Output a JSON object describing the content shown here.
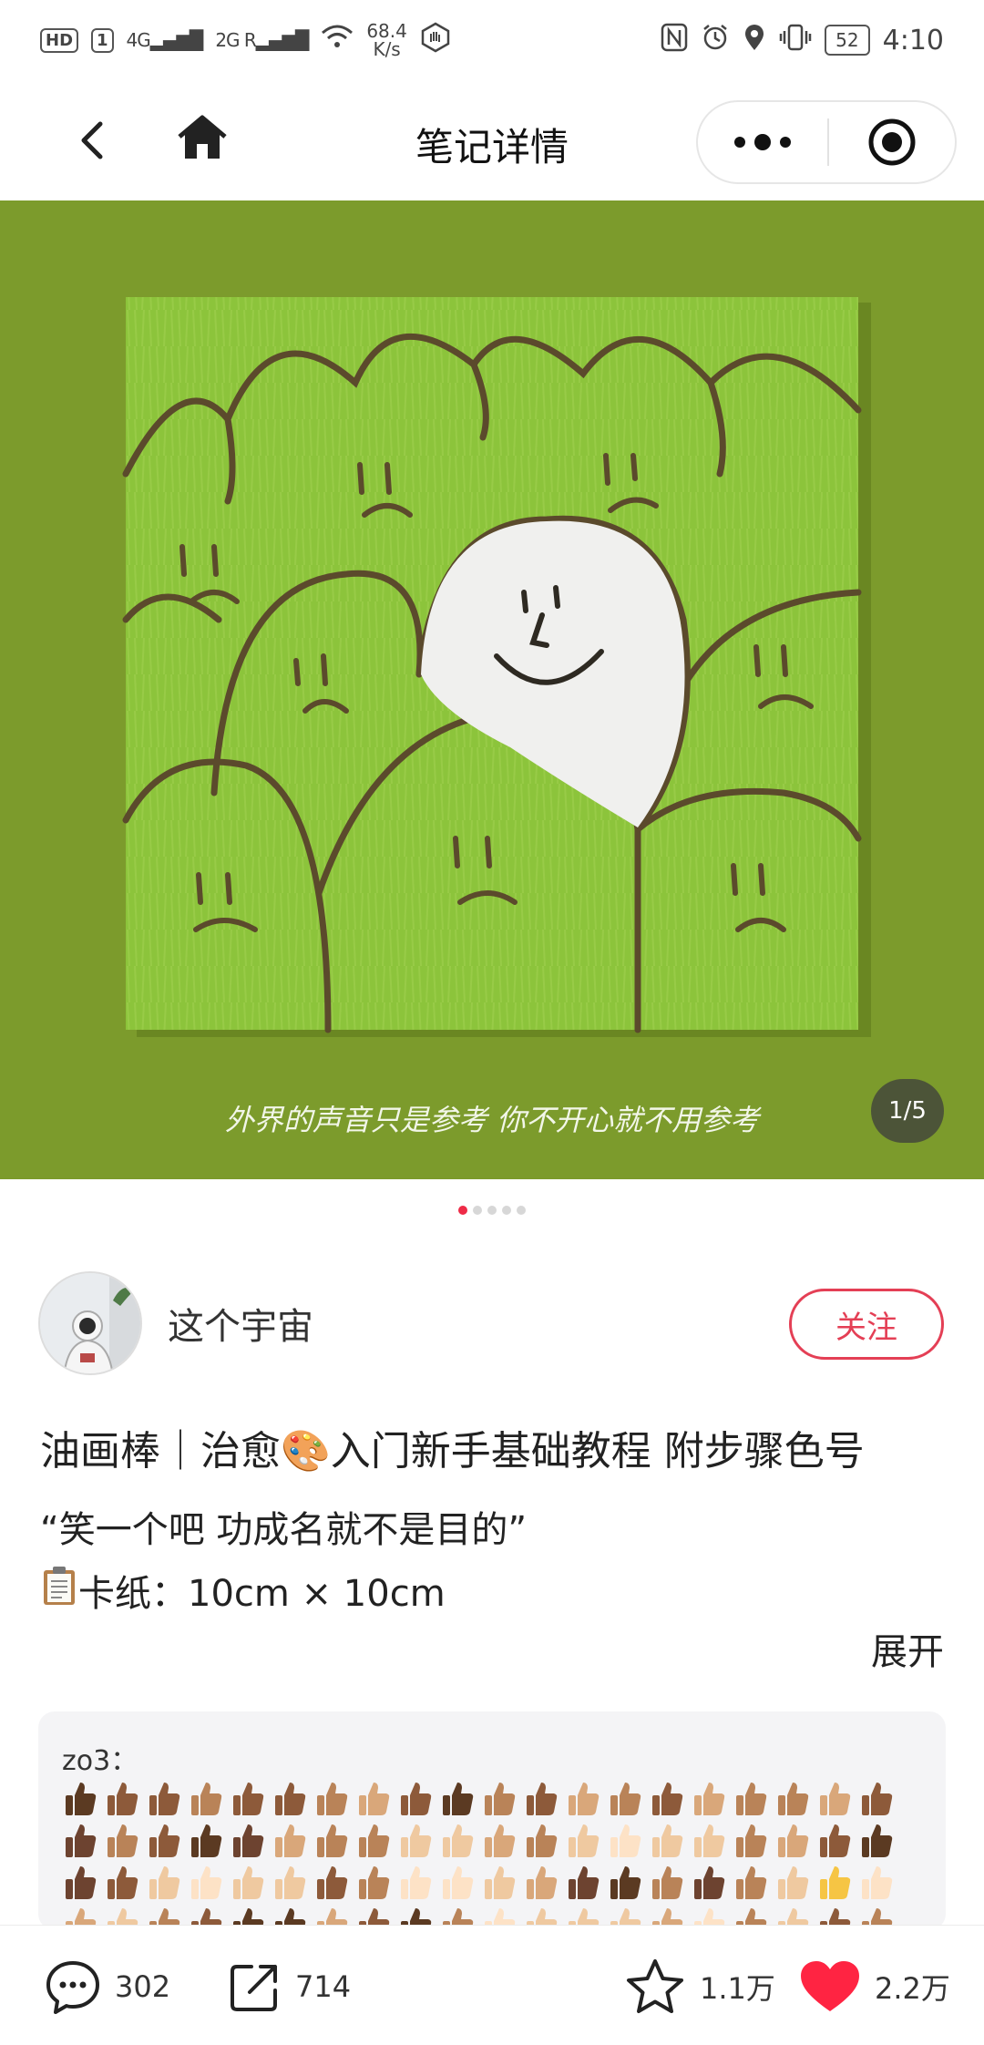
{
  "status_bar": {
    "left_icons": [
      "hd-icon",
      "sim-icon",
      "signal-4g-icon",
      "signal-2g-icon",
      "wifi-icon",
      "hand-icon"
    ],
    "hd_label": "HD",
    "sim_label": "1",
    "net1": "4G",
    "net2": "2G R",
    "speed_value": "68.4",
    "speed_unit": "K/s",
    "right_icons": [
      "nfc-icon",
      "alarm-icon",
      "location-icon",
      "vibrate-icon",
      "battery-icon"
    ],
    "battery": "52",
    "time": "4:10"
  },
  "nav": {
    "title": "笔记详情"
  },
  "hero": {
    "caption": "外界的声音只是参考 你不开心就不用参考",
    "counter": "1/5",
    "slide_count": 5,
    "active_index": 0,
    "colors": {
      "background": "#7c9b2c",
      "canvas": "#8cc43b",
      "outline": "#5b4a2c",
      "highlight": "#f0f0ee"
    }
  },
  "author": {
    "name": "这个宇宙",
    "follow_label": "关注"
  },
  "post": {
    "title_part1": "油画棒｜治愈",
    "title_emoji": "🎨",
    "title_part2": "入门新手基础教程 附步骤色号",
    "line1": "“笑一个吧 功成名就不是目的”",
    "line2_icon": "clipboard-icon",
    "line2_text": "卡纸：10cm × 10cm",
    "expand_label": "展开"
  },
  "comment": {
    "user": "zo3："
  },
  "bottom_bar": {
    "comments": "302",
    "shares": "714",
    "collects": "1.1万",
    "likes": "2.2万",
    "accent": "#ff2442"
  }
}
